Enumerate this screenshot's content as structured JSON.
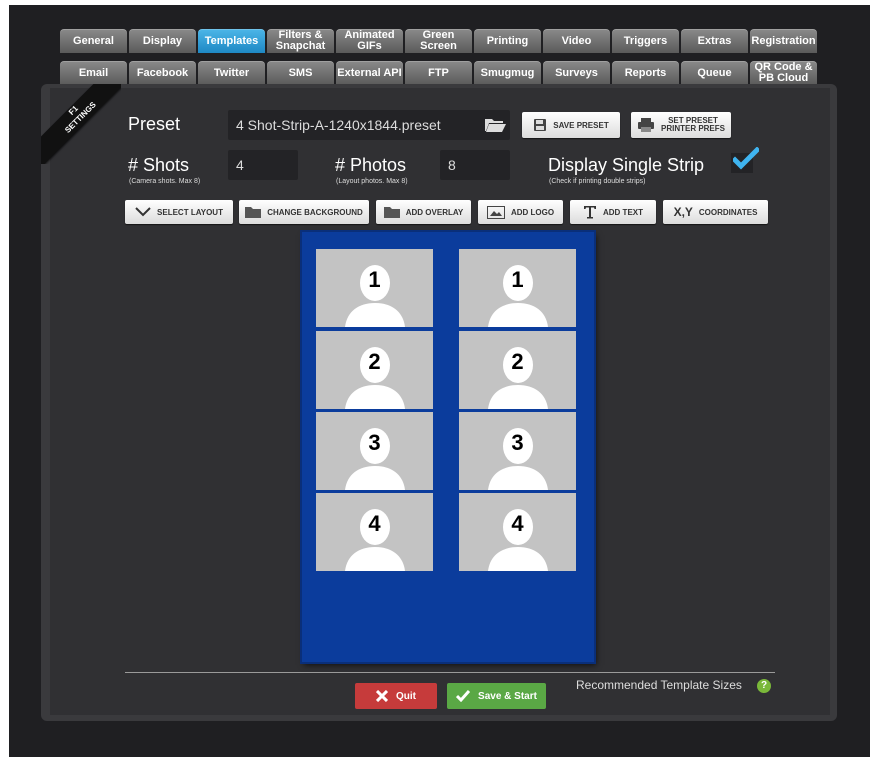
{
  "tabs_row1": [
    {
      "label": "General",
      "active": false
    },
    {
      "label": "Display",
      "active": false
    },
    {
      "label": "Templates",
      "active": true
    },
    {
      "label": "Filters &\nSnapchat",
      "active": false
    },
    {
      "label": "Animated\nGIFs",
      "active": false
    },
    {
      "label": "Green\nScreen",
      "active": false
    },
    {
      "label": "Printing",
      "active": false
    },
    {
      "label": "Video",
      "active": false
    },
    {
      "label": "Triggers",
      "active": false
    },
    {
      "label": "Extras",
      "active": false
    },
    {
      "label": "Registration",
      "active": false
    }
  ],
  "tabs_row2": [
    {
      "label": "Email"
    },
    {
      "label": "Facebook"
    },
    {
      "label": "Twitter"
    },
    {
      "label": "SMS"
    },
    {
      "label": "External API"
    },
    {
      "label": "FTP"
    },
    {
      "label": "Smugmug"
    },
    {
      "label": "Surveys"
    },
    {
      "label": "Reports"
    },
    {
      "label": "Queue"
    },
    {
      "label": "QR Code &\nPB Cloud"
    }
  ],
  "ribbon": {
    "key": "F1",
    "text": "SETTINGS"
  },
  "preset": {
    "label": "Preset",
    "value": "4 Shot-Strip-A-1240x1844.preset",
    "save_label": "SAVE PRESET",
    "printer_label": "SET PRESET\nPRINTER PREFS"
  },
  "shots": {
    "label": "# Shots",
    "sub": "(Camera shots. Max 8)",
    "value": "4"
  },
  "photos": {
    "label": "# Photos",
    "sub": "(Layout photos. Max 8)",
    "value": "8"
  },
  "single_strip": {
    "label": "Display Single Strip",
    "sub": "(Check if printing double strips)",
    "checked": true
  },
  "toolbar": {
    "select_layout": "SELECT LAYOUT",
    "change_background": "CHANGE BACKGROUND",
    "add_overlay": "ADD OVERLAY",
    "add_logo": "ADD LOGO",
    "add_text": "ADD TEXT",
    "coordinates": "COORDINATES",
    "xy_glyph": "X,Y"
  },
  "template": {
    "background": "#0b3c9c",
    "left_numbers": [
      "1",
      "2",
      "3",
      "4"
    ],
    "right_numbers": [
      "1",
      "2",
      "3",
      "4"
    ]
  },
  "footer": {
    "quit_label": "Quit",
    "save_start_label": "Save & Start",
    "recommended_label": "Recommended Template Sizes",
    "help_glyph": "?"
  },
  "colors": {
    "accent": "#2a9ad6",
    "quit": "#c63b3b",
    "save": "#5aa845"
  }
}
